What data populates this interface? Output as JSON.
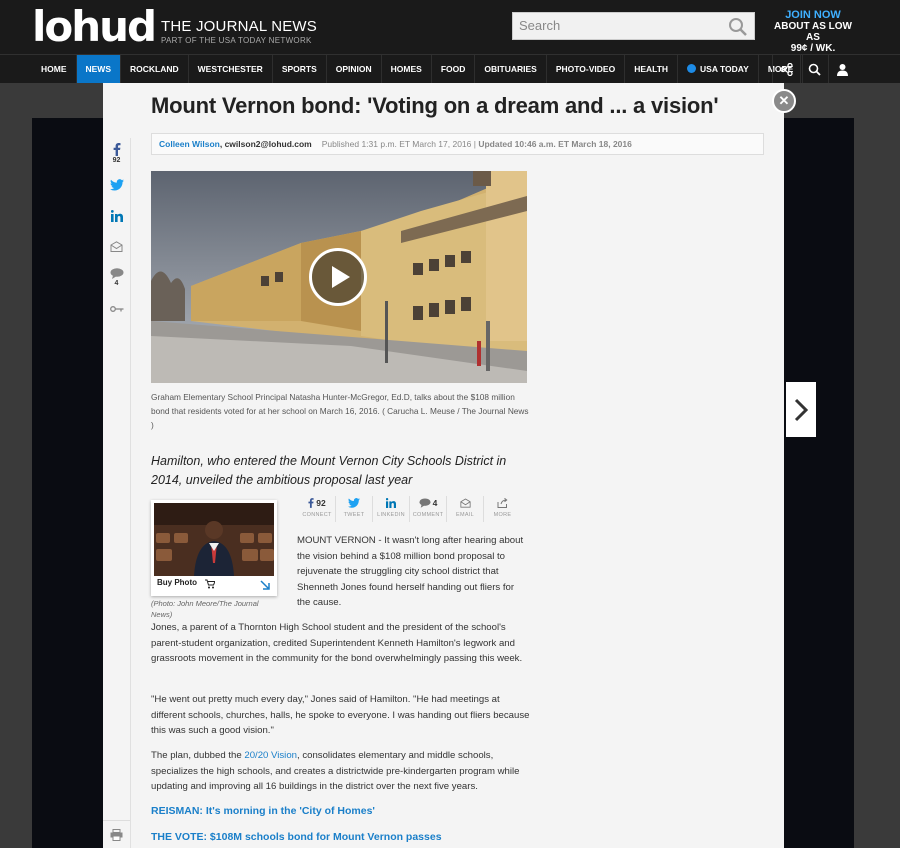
{
  "header": {
    "logo": "lohud",
    "paper_name": "THE JOURNAL NEWS",
    "paper_sub": "PART OF THE USA TODAY NETWORK",
    "search_placeholder": "Search",
    "promo_line1": "JOIN NOW",
    "promo_line2": "ABOUT AS LOW AS",
    "promo_line3": "99¢ / WK."
  },
  "nav": {
    "items": [
      {
        "label": "HOME",
        "active": false
      },
      {
        "label": "NEWS",
        "active": true
      },
      {
        "label": "ROCKLAND",
        "active": false
      },
      {
        "label": "WESTCHESTER",
        "active": false
      },
      {
        "label": "SPORTS",
        "active": false
      },
      {
        "label": "OPINION",
        "active": false
      },
      {
        "label": "HOMES",
        "active": false
      },
      {
        "label": "FOOD",
        "active": false
      },
      {
        "label": "OBITUARIES",
        "active": false
      },
      {
        "label": "PHOTO-VIDEO",
        "active": false
      },
      {
        "label": "HEALTH",
        "active": false
      },
      {
        "label": "USA TODAY",
        "active": false
      },
      {
        "label": "MORE",
        "active": false
      }
    ],
    "icons": [
      "share-icon",
      "search-icon",
      "user-icon"
    ]
  },
  "rail": {
    "facebook_count": "92",
    "comment_count": "4"
  },
  "article": {
    "headline": "Mount Vernon bond: 'Voting on a dream and ... a vision'",
    "author": "Colleen Wilson",
    "email": ", cwilson2@lohud.com",
    "published": "Published 1:31 p.m. ET March 17, 2016 |",
    "updated": " Updated 10:46 a.m. ET March 18, 2016",
    "video_caption": "Graham Elementary School Principal Natasha Hunter-McGregor, Ed.D, talks about the $108 million bond that residents voted for at her school on March 16, 2016. ( Carucha L. Meuse / The Journal News )",
    "summary": "Hamilton, who entered the Mount Vernon City Schools District in 2014, unveiled the ambitious proposal last year",
    "buy_photo": "Buy Photo",
    "photo_credit": "(Photo: John Meore/The Journal News)",
    "share": {
      "fb_count": "92",
      "comment_count": "4",
      "labels": [
        "CONNECT",
        "TWEET",
        "LINKEDIN",
        "COMMENT",
        "EMAIL",
        "MORE"
      ]
    },
    "p1": "MOUNT VERNON - It wasn't long after hearing about the vision behind a $108 million bond proposal to rejuvenate the struggling city school district that Shenneth Jones found herself handing out fliers for the cause.",
    "p2": "Jones, a parent of a Thornton High School student and the president of the school's parent-student organization, credited Superintendent Kenneth Hamilton's legwork and grassroots movement in the community for the bond overwhelmingly passing this week.",
    "p3": "\"He went out pretty much every day,\" Jones said of Hamilton. \"He had meetings at different schools, churches, halls, he spoke to everyone. I was handing out fliers because this was such a good vision.\"",
    "p4_before": "The plan, dubbed the ",
    "p4_link": "20/20 Vision",
    "p4_after": ", consolidates elementary and middle schools, specializes the high schools, and creates a districtwide pre-kindergarten program while updating and improving all 16 buildings in the district over the next five years.",
    "link1": "REISMAN: It's morning in the 'City of Homes'",
    "link2": "THE VOTE: $108M schools bond for Mount Vernon passes"
  }
}
